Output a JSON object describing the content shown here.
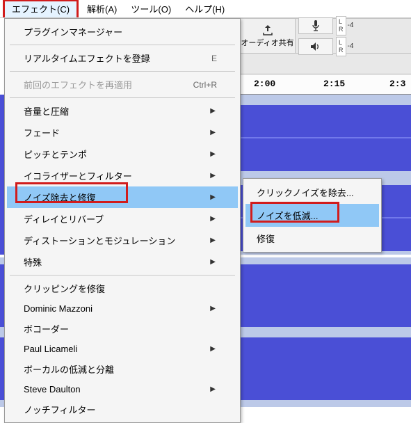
{
  "menubar": {
    "effect": "エフェクト(C)",
    "analyze": "解析(A)",
    "tools": "ツール(O)",
    "help": "ヘルプ(H)"
  },
  "toolbar": {
    "share_label": "オーディオ共有",
    "meter_L": "L",
    "meter_R": "R",
    "meter_val": "-4"
  },
  "timeline": {
    "t1": "2:00",
    "t2": "2:15",
    "t3": "2:3"
  },
  "dropdown": {
    "plugin_mgr": "プラグインマネージャー",
    "register_rt": "リアルタイムエフェクトを登録",
    "register_rt_key": "E",
    "repeat_last": "前回のエフェクトを再適用",
    "repeat_last_key": "Ctrl+R",
    "vol_comp": "音量と圧縮",
    "fade": "フェード",
    "pitch_tempo": "ピッチとテンポ",
    "eq_filter": "イコライザーとフィルター",
    "noise": "ノイズ除去と修復",
    "delay_rev": "ディレイとリバーブ",
    "dist_mod": "ディストーションとモジュレーション",
    "special": "特殊",
    "clip_fix": "クリッピングを修復",
    "dominic": "Dominic Mazzoni",
    "vocoder": "ボコーダー",
    "paul": "Paul Licameli",
    "vocal": "ボーカルの低減と分離",
    "steve": "Steve Daulton",
    "notch": "ノッチフィルター"
  },
  "submenu": {
    "click_removal": "クリックノイズを除去...",
    "noise_reduce": "ノイズを低減...",
    "repair": "修復"
  }
}
